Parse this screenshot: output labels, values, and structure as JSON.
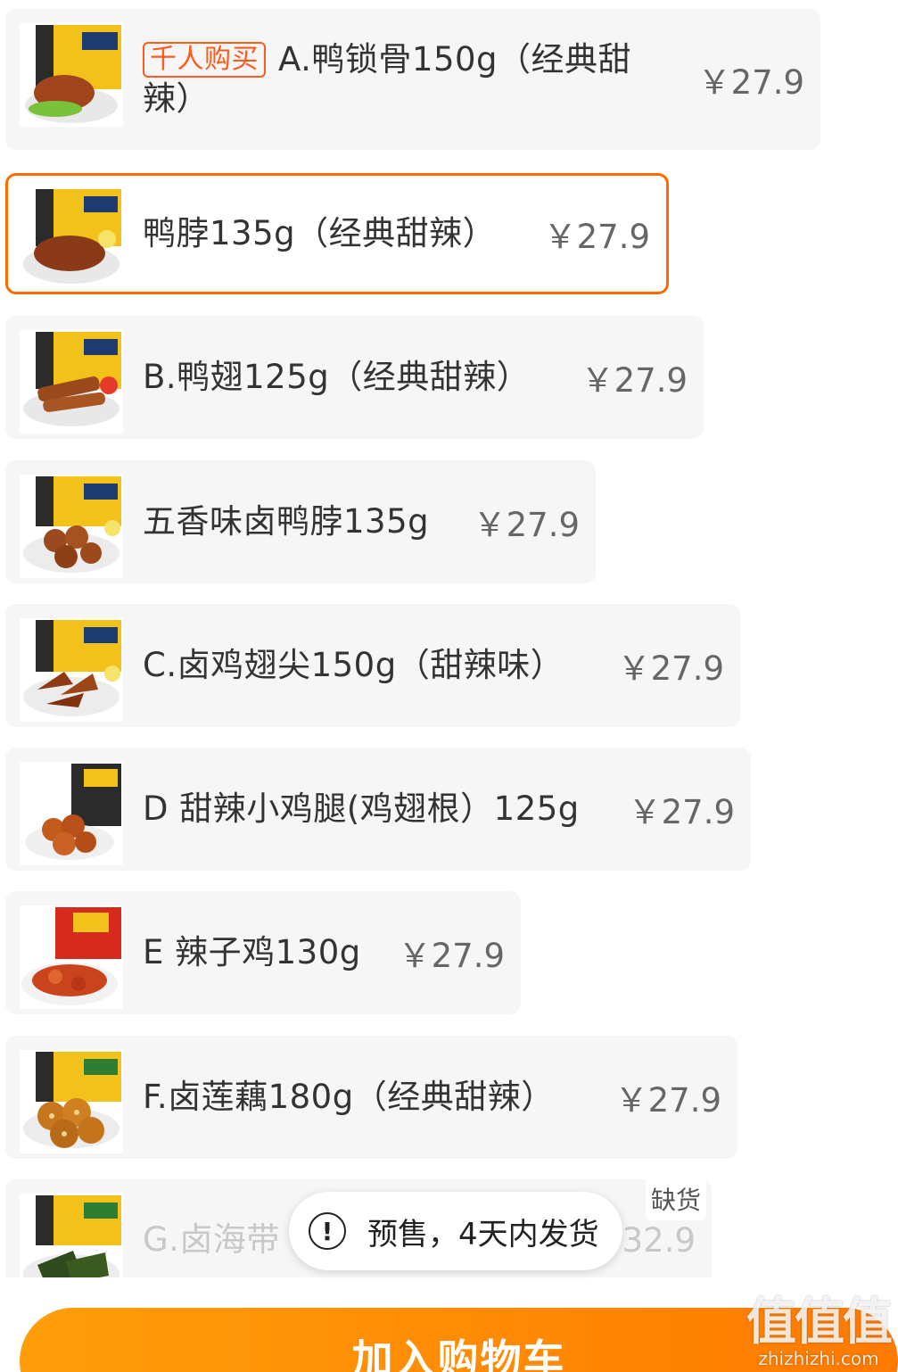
{
  "skus": [
    {
      "tag": "千人购买",
      "name": "A.鸭锁骨150g（经典甜辣）",
      "price": "￥27.9",
      "image": "duck-collarbone-pack-image"
    },
    {
      "name": "鸭脖135g（经典甜辣）",
      "price": "￥27.9",
      "selected": true,
      "image": "duck-neck-pack-image"
    },
    {
      "name": "B.鸭翅125g（经典甜辣）",
      "price": "￥27.9",
      "image": "duck-wing-pack-image"
    },
    {
      "name": "五香味卤鸭脖135g",
      "price": "￥27.9",
      "image": "five-spice-duck-neck-pack-image"
    },
    {
      "name": "C.卤鸡翅尖150g（甜辣味）",
      "price": "￥27.9",
      "image": "chicken-wing-tip-pack-image"
    },
    {
      "name": "D 甜辣小鸡腿(鸡翅根）125g",
      "price": "￥27.9",
      "image": "chicken-drumette-pack-image"
    },
    {
      "name": "E 辣子鸡130g",
      "price": "￥27.9",
      "image": "spicy-chicken-pack-image"
    },
    {
      "name": "F.卤莲藕180g（经典甜辣）",
      "price": "￥27.9",
      "image": "lotus-root-pack-image"
    },
    {
      "name": "G.卤海带",
      "price": "32.9",
      "status": "缺货",
      "image": "kelp-pack-image"
    }
  ],
  "toast": {
    "icon": "exclamation-icon",
    "text": "预售，4天内发货"
  },
  "cta": {
    "label": "加入购物车",
    "color": "#ff8a00"
  },
  "colors": {
    "accent": "#ff6a00",
    "tag": "#ff5a1f",
    "card_bg": "#f6f6f6"
  },
  "watermark": {
    "logo": "值值值",
    "url": "zhizhizhi.com"
  }
}
